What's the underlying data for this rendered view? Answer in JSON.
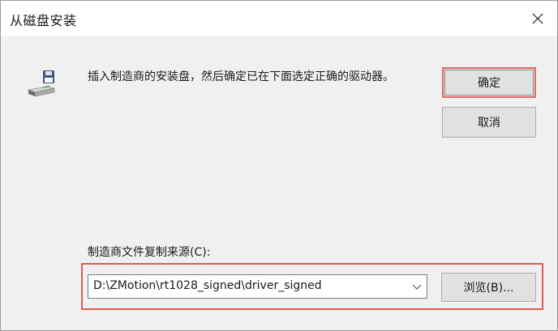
{
  "window": {
    "title": "从磁盘安装"
  },
  "message": {
    "text": "插入制造商的安装盘，然后确定已在下面选定正确的驱动器。"
  },
  "buttons": {
    "ok_label": "确定",
    "cancel_label": "取消",
    "browse_label": "浏览(B)..."
  },
  "source": {
    "label": "制造商文件复制来源(C):",
    "path_value": "D:\\ZMotion\\rt1028_signed\\driver_signed"
  },
  "icons": {
    "close": "close-icon",
    "disk": "floppy-disk-drive-icon",
    "combo_arrow": "chevron-down-icon"
  },
  "colors": {
    "highlight": "#e05a5a",
    "window_bg": "#f0f0f0",
    "button_bg": "#e1e1e1"
  }
}
